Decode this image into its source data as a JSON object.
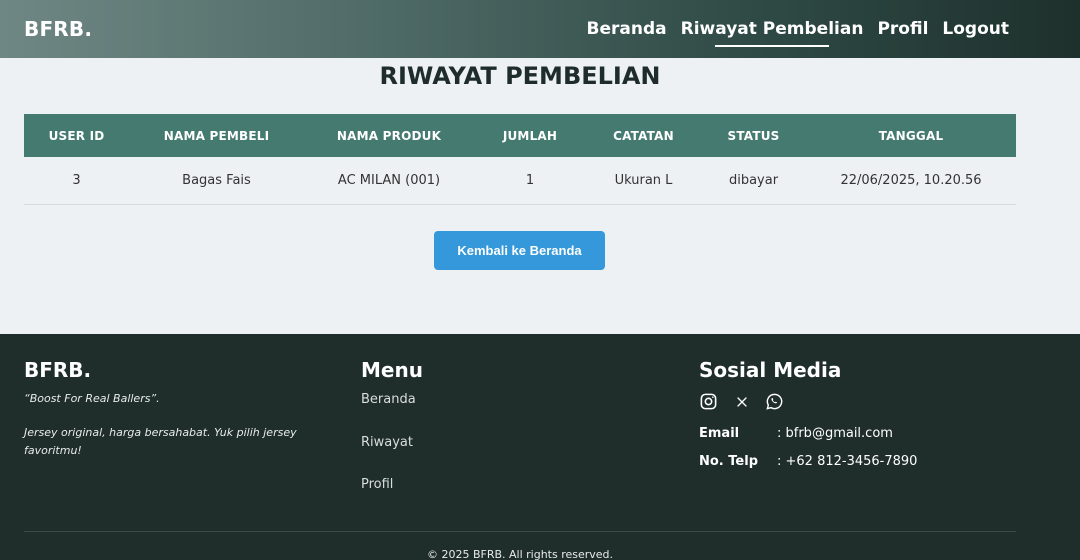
{
  "navbar": {
    "brand": "BFRB.",
    "links": [
      {
        "label": "Beranda"
      },
      {
        "label": "Riwayat Pembelian"
      },
      {
        "label": "Profil"
      },
      {
        "label": "Logout"
      }
    ]
  },
  "main": {
    "title": "RIWAYAT PEMBELIAN",
    "table": {
      "headers": [
        "USER ID",
        "NAMA PEMBELI",
        "NAMA PRODUK",
        "JUMLAH",
        "CATATAN",
        "STATUS",
        "TANGGAL"
      ],
      "rows": [
        [
          "3",
          "Bagas Fais",
          "AC MILAN (001)",
          "1",
          "Ukuran L",
          "dibayar",
          "22/06/2025, 10.20.56"
        ]
      ]
    },
    "back_button": "Kembali ke Beranda"
  },
  "footer": {
    "brand": "BFRB.",
    "tagline": "“Boost For Real Ballers”.",
    "description": "Jersey original, harga bersahabat. Yuk pilih jersey favoritmu!",
    "menu_title": "Menu",
    "menu_items": [
      "Beranda",
      "Riwayat",
      "Profil"
    ],
    "social_title": "Sosial Media",
    "social_icons": [
      "instagram-icon",
      "x-icon",
      "whatsapp-icon"
    ],
    "email_label": "Email",
    "email_value": ": bfrb@gmail.com",
    "phone_label": "No. Telp",
    "phone_value": ": +62 812-3456-7890",
    "copyright": "© 2025 BFRB. All rights reserved."
  },
  "colors": {
    "table_header": "#447a70",
    "button": "#3498db",
    "footer_bg": "#1f2d2b"
  }
}
